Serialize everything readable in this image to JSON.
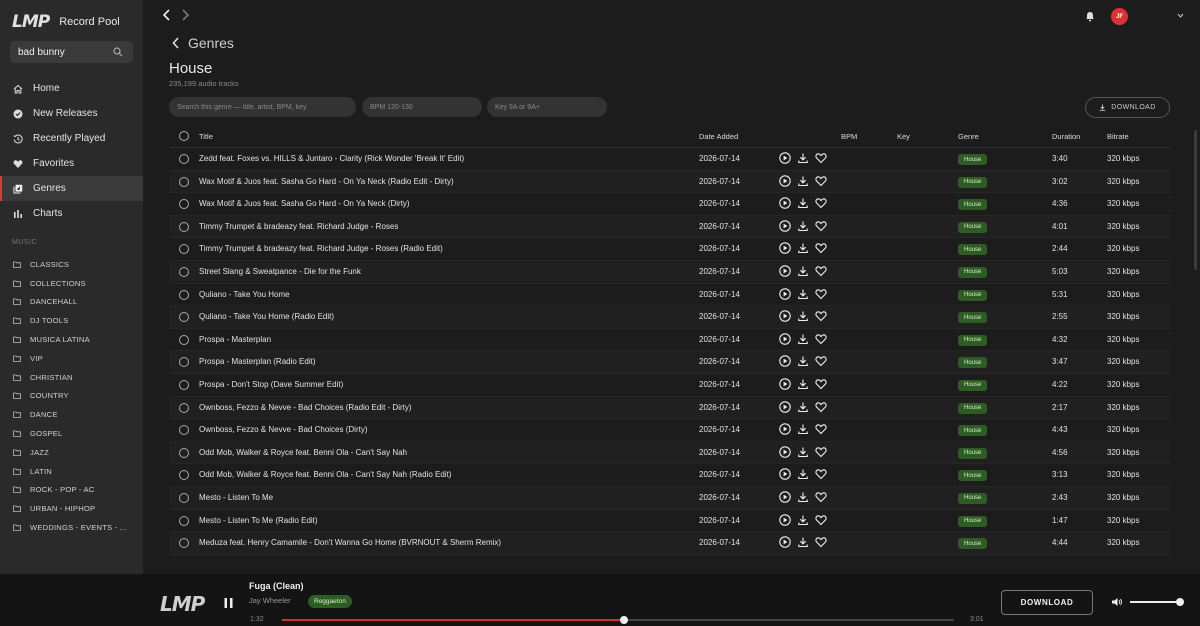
{
  "brand": {
    "logo": "LMP",
    "name": "Record Pool"
  },
  "search": {
    "value": "bad bunny"
  },
  "nav": [
    {
      "label": "Home",
      "icon": "home-icon",
      "active": false
    },
    {
      "label": "New Releases",
      "icon": "badge-check-icon",
      "active": false
    },
    {
      "label": "Recently Played",
      "icon": "history-icon",
      "active": false
    },
    {
      "label": "Favorites",
      "icon": "heart-icon",
      "active": false
    },
    {
      "label": "Genres",
      "icon": "library-icon",
      "active": true
    },
    {
      "label": "Charts",
      "icon": "bar-chart-icon",
      "active": false
    }
  ],
  "music_section_label": "MUSIC",
  "folders": [
    "CLASSICS",
    "COLLECTIONS",
    "DANCEHALL",
    "DJ TOOLS",
    "MUSICA LATINA",
    "VIP",
    "CHRISTIAN",
    "COUNTRY",
    "DANCE",
    "GOSPEL",
    "JAZZ",
    "LATIN",
    "ROCK - POP - AC",
    "URBAN - HIPHOP",
    "WEDDINGS - EVENTS - ..."
  ],
  "user": {
    "initials": "JF"
  },
  "header": {
    "back_label": "Genres",
    "title": "House",
    "subtitle": "235,199 audio tracks"
  },
  "filters": {
    "search_placeholder": "Search this genre — title, artist, BPM, key",
    "bpm_placeholder": "BPM 120-130",
    "key_placeholder": "Key 9A or 9A+"
  },
  "download_all_label": "DOWNLOAD",
  "columns": {
    "title": "Title",
    "date": "Date Added",
    "bpm": "BPM",
    "key": "Key",
    "genre": "Genre",
    "duration": "Duration",
    "bitrate": "Bitrate"
  },
  "tracks": [
    {
      "title": "Zedd feat. Foxes vs. HILLS & Juntaro - Clarity (Rick Wonder 'Break It' Edit)",
      "date": "2026-07-14",
      "genre": "House",
      "duration": "3:40",
      "bitrate": "320 kbps"
    },
    {
      "title": "Wax Motif & Juos feat. Sasha Go Hard - On Ya Neck (Radio Edit - Dirty)",
      "date": "2026-07-14",
      "genre": "House",
      "duration": "3:02",
      "bitrate": "320 kbps"
    },
    {
      "title": "Wax Motif & Juos feat. Sasha Go Hard - On Ya Neck (Dirty)",
      "date": "2026-07-14",
      "genre": "House",
      "duration": "4:36",
      "bitrate": "320 kbps"
    },
    {
      "title": "Timmy Trumpet & bradeazy feat. Richard Judge - Roses",
      "date": "2026-07-14",
      "genre": "House",
      "duration": "4:01",
      "bitrate": "320 kbps"
    },
    {
      "title": "Timmy Trumpet & bradeazy feat. Richard Judge - Roses (Radio Edit)",
      "date": "2026-07-14",
      "genre": "House",
      "duration": "2:44",
      "bitrate": "320 kbps"
    },
    {
      "title": "Street Slang & Sweatpance - Die for the Funk",
      "date": "2026-07-14",
      "genre": "House",
      "duration": "5:03",
      "bitrate": "320 kbps"
    },
    {
      "title": "Quliano - Take You Home",
      "date": "2026-07-14",
      "genre": "House",
      "duration": "5:31",
      "bitrate": "320 kbps"
    },
    {
      "title": "Quliano - Take You Home (Radio Edit)",
      "date": "2026-07-14",
      "genre": "House",
      "duration": "2:55",
      "bitrate": "320 kbps"
    },
    {
      "title": "Prospa - Masterplan",
      "date": "2026-07-14",
      "genre": "House",
      "duration": "4:32",
      "bitrate": "320 kbps"
    },
    {
      "title": "Prospa - Masterplan (Radio Edit)",
      "date": "2026-07-14",
      "genre": "House",
      "duration": "3:47",
      "bitrate": "320 kbps"
    },
    {
      "title": "Prospa - Don't Stop (Dave Summer Edit)",
      "date": "2026-07-14",
      "genre": "House",
      "duration": "4:22",
      "bitrate": "320 kbps"
    },
    {
      "title": "Ownboss, Fezzo & Nevve - Bad Choices (Radio Edit - Dirty)",
      "date": "2026-07-14",
      "genre": "House",
      "duration": "2:17",
      "bitrate": "320 kbps"
    },
    {
      "title": "Ownboss, Fezzo & Nevve - Bad Choices (Dirty)",
      "date": "2026-07-14",
      "genre": "House",
      "duration": "4:43",
      "bitrate": "320 kbps"
    },
    {
      "title": "Odd Mob, Walker & Royce feat. Benni Ola - Can't Say Nah",
      "date": "2026-07-14",
      "genre": "House",
      "duration": "4:56",
      "bitrate": "320 kbps"
    },
    {
      "title": "Odd Mob, Walker & Royce feat. Benni Ola - Can't Say Nah (Radio Edit)",
      "date": "2026-07-14",
      "genre": "House",
      "duration": "3:13",
      "bitrate": "320 kbps"
    },
    {
      "title": "Mesto - Listen To Me",
      "date": "2026-07-14",
      "genre": "House",
      "duration": "2:43",
      "bitrate": "320 kbps"
    },
    {
      "title": "Mesto - Listen To Me (Radio Edit)",
      "date": "2026-07-14",
      "genre": "House",
      "duration": "1:47",
      "bitrate": "320 kbps"
    },
    {
      "title": "Meduza feat. Henry Camamile - Don't Wanna Go Home (BVRNOUT & Sherm Remix)",
      "date": "2026-07-14",
      "genre": "House",
      "duration": "4:44",
      "bitrate": "320 kbps"
    }
  ],
  "player": {
    "logo": "LMP",
    "title": "Fuga (Clean)",
    "artist": "Jay Wheeler",
    "genre": "Reggaeton",
    "current_time": "1:32",
    "total_time": "3:01",
    "progress": 0.509,
    "volume": 1.0,
    "download_label": "DOWNLOAD"
  },
  "colors": {
    "accent": "#d93232",
    "badge_bg": "#2e5c25",
    "sidebar_bg": "#2a2a2a",
    "main_bg": "#1c1c1c"
  }
}
